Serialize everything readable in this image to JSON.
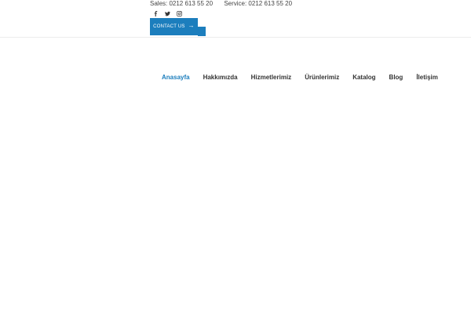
{
  "topbar": {
    "sales": "Sales: 0212 613 55 20",
    "service": "Service: 0212 613 55 20",
    "socials": [
      "facebook-icon",
      "twitter-icon",
      "instagram-icon"
    ],
    "contact_button": "CONTACT US",
    "contact_arrow": "→"
  },
  "nav": {
    "items": [
      {
        "label": "Anasayfa",
        "active": true
      },
      {
        "label": "Hakkımızda"
      },
      {
        "label": "Hizmetlerimiz"
      },
      {
        "label": "Ürünlerimiz"
      },
      {
        "label": "Katalog"
      },
      {
        "label": "Blog"
      },
      {
        "label": "İletişim"
      }
    ]
  },
  "colors": {
    "accent": "#1c7ebd",
    "text": "#333333"
  }
}
